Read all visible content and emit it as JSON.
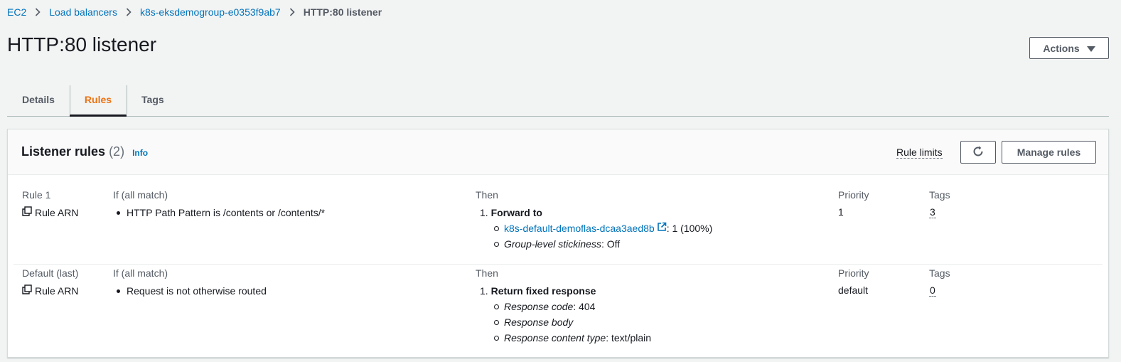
{
  "breadcrumb": {
    "items": [
      "EC2",
      "Load balancers",
      "k8s-eksdemogroup-e0353f9ab7"
    ],
    "current": "HTTP:80 listener"
  },
  "page": {
    "title": "HTTP:80 listener",
    "actions_label": "Actions"
  },
  "tabs": [
    {
      "label": "Details"
    },
    {
      "label": "Rules",
      "active": true
    },
    {
      "label": "Tags"
    }
  ],
  "listener_rules": {
    "title": "Listener rules",
    "count": "(2)",
    "info_label": "Info",
    "rule_limits_label": "Rule limits",
    "manage_rules_label": "Manage rules"
  },
  "columns": {
    "if_label": "If (all match)",
    "then_label": "Then",
    "priority_label": "Priority",
    "tags_label": "Tags",
    "arn_label": "Rule ARN"
  },
  "rules": [
    {
      "name": "Rule 1",
      "condition": "HTTP Path Pattern is /contents or /contents/*",
      "action_num": "1.",
      "action": "Forward to",
      "target_group": "k8s-default-demoflas-dcaa3aed8b",
      "target_weight": ": 1 (100%)",
      "stickiness_label": "Group-level stickiness",
      "stickiness_value": ": Off",
      "priority": "1",
      "tags": "3"
    },
    {
      "name": "Default (last)",
      "condition": "Request is not otherwise routed",
      "action_num": "1.",
      "action": "Return fixed response",
      "response_code_label": "Response code",
      "response_code_value": ": 404",
      "response_body_label": "Response body",
      "content_type_label": "Response content type",
      "content_type_value": ": text/plain",
      "priority": "default",
      "tags": "0"
    }
  ],
  "colors": {
    "link": "#0073bb",
    "active_tab": "#ec7211",
    "background": "#f2f3f3"
  }
}
